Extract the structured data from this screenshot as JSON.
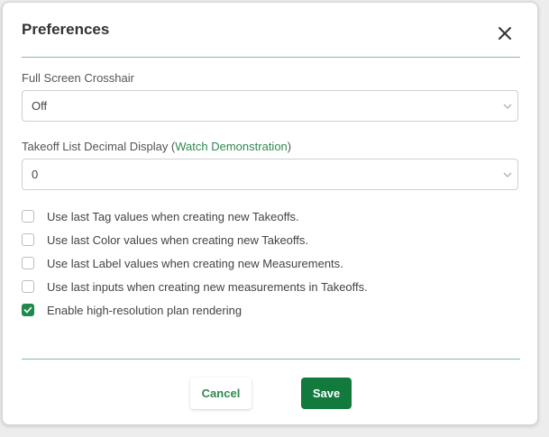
{
  "dialog": {
    "title": "Preferences",
    "close_icon": "close-icon"
  },
  "crosshair": {
    "label": "Full Screen Crosshair",
    "value": "Off"
  },
  "decimal": {
    "label_prefix": "Takeoff List Decimal Display (",
    "link": "Watch Demonstration",
    "label_suffix": ")",
    "value": "0"
  },
  "checkboxes": [
    {
      "label": "Use last Tag values when creating new Takeoffs.",
      "checked": false
    },
    {
      "label": "Use last Color values when creating new Takeoffs.",
      "checked": false
    },
    {
      "label": "Use last Label values when creating new Measurements.",
      "checked": false
    },
    {
      "label": "Use last inputs when creating new measurements in Takeoffs.",
      "checked": false
    },
    {
      "label": "Enable high-resolution plan rendering",
      "checked": true
    }
  ],
  "buttons": {
    "cancel": "Cancel",
    "save": "Save"
  },
  "colors": {
    "accent": "#137a3d",
    "link": "#2f8a52",
    "divider": "#7fbf96"
  }
}
